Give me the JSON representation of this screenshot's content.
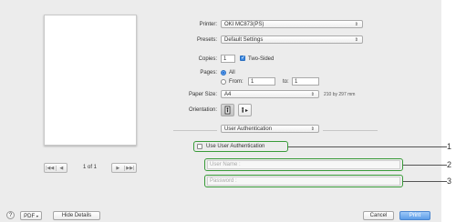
{
  "dialog": {
    "printer_label": "Printer:",
    "printer_value": "OKI MC873(PS)",
    "presets_label": "Presets:",
    "presets_value": "Default Settings",
    "copies_label": "Copies:",
    "copies_value": "1",
    "two_sided_label": "Two-Sided",
    "pages_label": "Pages:",
    "pages_all_label": "All",
    "pages_from_label": "From:",
    "pages_from_value": "1",
    "pages_to_label": "to:",
    "pages_to_value": "1",
    "paper_size_label": "Paper Size:",
    "paper_size_value": "A4",
    "paper_size_dims": "210 by 297 mm",
    "orientation_label": "Orientation:",
    "section_popup_value": "User Authentication",
    "use_auth_label": "Use User Authentication",
    "user_name_placeholder": "User Name :",
    "password_placeholder": "Password :"
  },
  "preview": {
    "page_counter": "1 of 1",
    "first_glyph": "|◀◀",
    "prev_glyph": "◀",
    "next_glyph": "▶",
    "last_glyph": "▶▶|"
  },
  "footer": {
    "help_glyph": "?",
    "pdf_label": "PDF",
    "hide_details_label": "Hide Details",
    "cancel_label": "Cancel",
    "print_label": "Print"
  },
  "callouts": [
    "1",
    "2",
    "3"
  ],
  "colors": {
    "highlight": "#3a9b3a",
    "primary_button": "#5d9ee8",
    "panel_bg": "#ececec"
  },
  "icons": {
    "portrait": "portrait-orientation-icon",
    "landscape": "landscape-orientation-icon",
    "popup_arrow": "updown-arrow-icon"
  }
}
